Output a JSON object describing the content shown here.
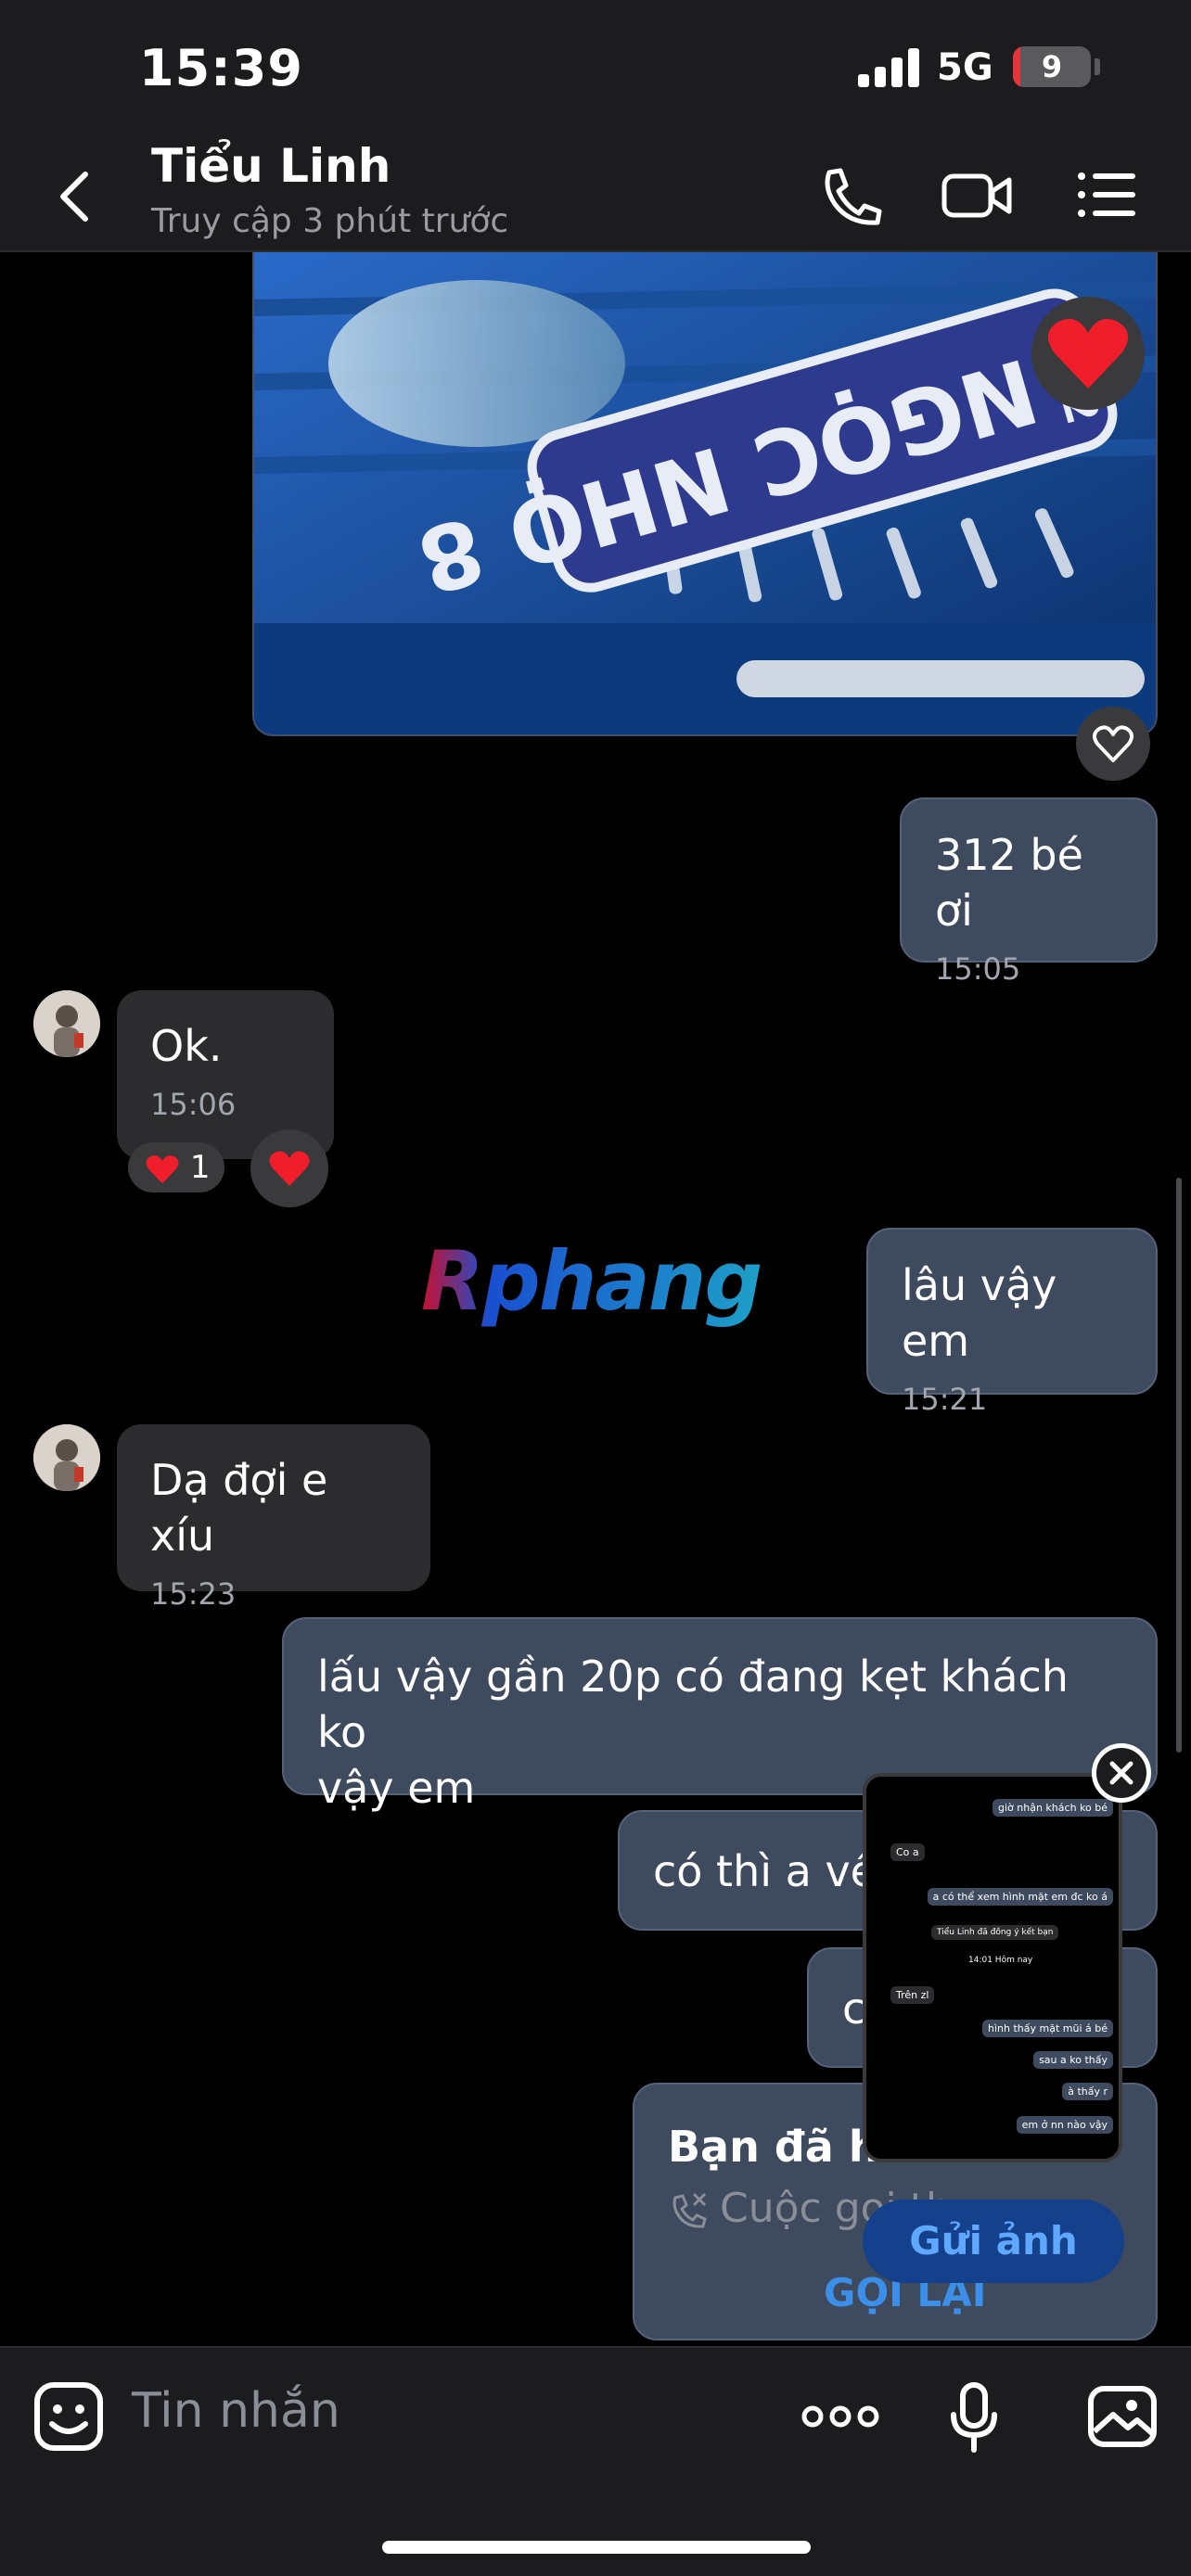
{
  "status_bar": {
    "time": "15:39",
    "network": "5G",
    "battery": "9",
    "battery_level": 0.09
  },
  "header": {
    "name": "Tiểu Linh",
    "subtitle": "Truy cập 3 phút trước"
  },
  "photo": {
    "plate_text": "8 ỌHN OÓGN 312",
    "reaction": "heart"
  },
  "messages": [
    {
      "dir": "out",
      "text": "312 bé ơi",
      "time": "15:05"
    },
    {
      "dir": "in",
      "text": "Ok.",
      "time": "15:06",
      "reaction_count": "1"
    },
    {
      "dir": "out",
      "text": "lâu vậy em",
      "time": "15:21"
    },
    {
      "dir": "in",
      "text": "Dạ đợi e xíu",
      "time": "15:23"
    },
    {
      "dir": "out",
      "text": "lấu vậy gần 20p có đang kẹt khách ko\nvậy em"
    },
    {
      "dir": "out",
      "text": "có thì a về"
    },
    {
      "dir": "out",
      "text": "c"
    }
  ],
  "missed_call": {
    "title": "Bạn đã hủ",
    "subtitle": "Cuộc gọi th",
    "action": "GỌI LẠI"
  },
  "watermark": "Rphang",
  "preview": {
    "items": [
      "giờ nhận khách ko bé",
      "Co a",
      "a có thể xem hình mặt em đc ko á",
      "Tiểu Linh đã đồng ý kết bạn",
      "14:01 Hôm nay",
      "Trên zl",
      "hình thấy mặt mũi á bé",
      "sau a ko thấy",
      "à thấy r",
      "em ở nn nào vậy"
    ],
    "send_label": "Gửi ảnh"
  },
  "input": {
    "placeholder": "Tin nhắn"
  },
  "colors": {
    "out_bubble": "#3e4a5e",
    "in_bubble": "#2c2c2e",
    "accent": "#3b8fe8"
  }
}
